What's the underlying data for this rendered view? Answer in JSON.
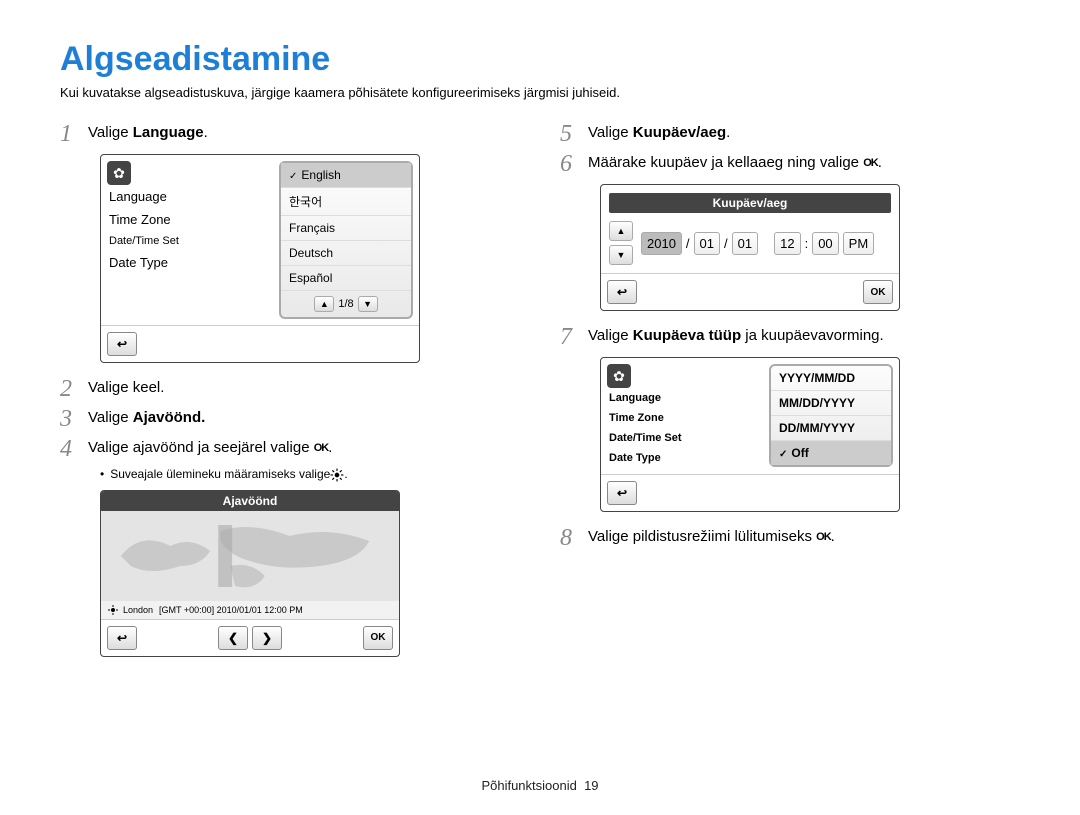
{
  "title": "Algseadistamine",
  "intro": "Kui kuvatakse algseadistuskuva, järgige kaamera põhisätete konfigureerimiseks järgmisi juhiseid.",
  "ok_glyph": "OK",
  "steps": {
    "s1": {
      "pre": "Valige ",
      "bold": "Language",
      "post": "."
    },
    "s2": {
      "text": "Valige keel."
    },
    "s3": {
      "pre": "Valige ",
      "bold": "Ajavöönd."
    },
    "s4": {
      "text": "Valige ajavöönd ja seejärel valige "
    },
    "s4b": {
      "text": "Suveajale ülemineku määramiseks valige "
    },
    "s5": {
      "pre": "Valige ",
      "bold": "Kuupäev/aeg",
      "post": "."
    },
    "s6": {
      "text": "Määrake kuupäev ja kellaaeg ning valige "
    },
    "s7": {
      "pre": "Valige ",
      "bold": "Kuupäeva tüüp",
      "post": " ja kuupäevavorming."
    },
    "s8": {
      "text": "Valige pildistusrežiimi lülitumiseks "
    }
  },
  "lang_panel": {
    "left": [
      "Language",
      "Time Zone",
      "Date/Time Set",
      "Date Type"
    ],
    "options": [
      "English",
      "한국어",
      "Français",
      "Deutsch",
      "Español"
    ],
    "pager": "1/8"
  },
  "tz_panel": {
    "title": "Ajavöönd",
    "city": "London",
    "info": "[GMT +00:00] 2010/01/01 12:00 PM"
  },
  "dt_panel": {
    "title": "Kuupäev/aeg",
    "year": "2010",
    "m": "01",
    "d": "01",
    "hh": "12",
    "mm": "00",
    "ampm": "PM",
    "sep1": "/",
    "sep2": "/",
    "sep3": ":"
  },
  "type_panel": {
    "left": [
      "Language",
      "Time Zone",
      "Date/Time Set",
      "Date Type"
    ],
    "options": [
      "YYYY/MM/DD",
      "MM/DD/YYYY",
      "DD/MM/YYYY",
      "Off"
    ]
  },
  "footer": {
    "label": "Põhifunktsioonid",
    "page": "19"
  }
}
